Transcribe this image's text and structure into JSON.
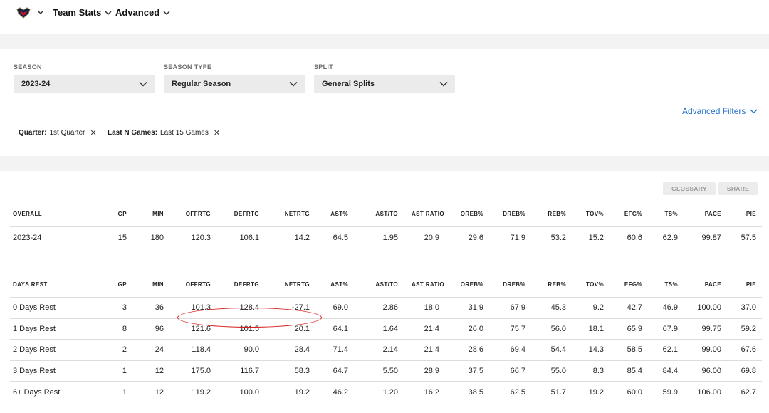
{
  "nav": {
    "team_stats": "Team Stats",
    "advanced": "Advanced"
  },
  "filters": [
    {
      "label": "SEASON",
      "value": "2023-24"
    },
    {
      "label": "SEASON TYPE",
      "value": "Regular Season"
    },
    {
      "label": "SPLIT",
      "value": "General Splits"
    }
  ],
  "advanced_filters": "Advanced Filters",
  "chips": [
    {
      "key": "Quarter:",
      "value": "1st Quarter"
    },
    {
      "key": "Last N Games:",
      "value": "Last 15 Games"
    }
  ],
  "buttons": {
    "glossary": "GLOSSARY",
    "share": "SHARE"
  },
  "overall": {
    "headers": [
      "OVERALL",
      "GP",
      "MIN",
      "OFFRTG",
      "DEFRTG",
      "NETRTG",
      "AST%",
      "AST/TO",
      "AST RATIO",
      "OREB%",
      "DREB%",
      "REB%",
      "TOV%",
      "EFG%",
      "TS%",
      "PACE",
      "PIE"
    ],
    "rows": [
      [
        "2023-24",
        "15",
        "180",
        "120.3",
        "106.1",
        "14.2",
        "64.5",
        "1.95",
        "20.9",
        "29.6",
        "71.9",
        "53.2",
        "15.2",
        "60.6",
        "62.9",
        "99.87",
        "57.5"
      ]
    ]
  },
  "days_rest": {
    "headers": [
      "DAYS REST",
      "GP",
      "MIN",
      "OFFRTG",
      "DEFRTG",
      "NETRTG",
      "AST%",
      "AST/TO",
      "AST RATIO",
      "OREB%",
      "DREB%",
      "REB%",
      "TOV%",
      "EFG%",
      "TS%",
      "PACE",
      "PIE"
    ],
    "rows": [
      [
        "0 Days Rest",
        "3",
        "36",
        "101.3",
        "128.4",
        "-27.1",
        "69.0",
        "2.86",
        "18.0",
        "31.9",
        "67.9",
        "45.3",
        "9.2",
        "42.7",
        "46.9",
        "100.00",
        "37.0"
      ],
      [
        "1 Days Rest",
        "8",
        "96",
        "121.6",
        "101.5",
        "20.1",
        "64.1",
        "1.64",
        "21.4",
        "26.0",
        "75.7",
        "56.0",
        "18.1",
        "65.9",
        "67.9",
        "99.75",
        "59.2"
      ],
      [
        "2 Days Rest",
        "2",
        "24",
        "118.4",
        "90.0",
        "28.4",
        "71.4",
        "2.14",
        "21.4",
        "28.6",
        "69.4",
        "54.4",
        "14.3",
        "58.5",
        "62.1",
        "99.00",
        "67.6"
      ],
      [
        "3 Days Rest",
        "1",
        "12",
        "175.0",
        "116.7",
        "58.3",
        "64.7",
        "5.50",
        "28.9",
        "37.5",
        "66.7",
        "55.0",
        "8.3",
        "85.4",
        "84.4",
        "96.00",
        "69.8"
      ],
      [
        "6+ Days Rest",
        "1",
        "12",
        "119.2",
        "100.0",
        "19.2",
        "46.2",
        "1.20",
        "16.2",
        "38.5",
        "62.5",
        "51.7",
        "19.2",
        "60.0",
        "59.9",
        "106.00",
        "62.7"
      ]
    ]
  },
  "colors": {
    "accent_link": "#1d6ec9",
    "annotation": "#d92020",
    "band": "#f3f3f3"
  }
}
